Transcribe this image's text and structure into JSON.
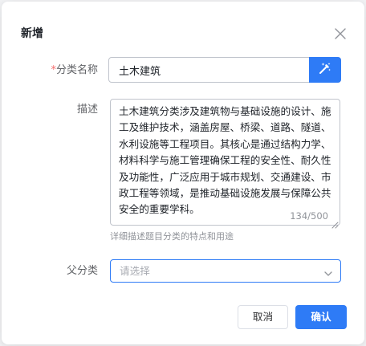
{
  "dialog": {
    "title": "新增",
    "close_icon": "close-icon"
  },
  "form": {
    "name": {
      "required_mark": "*",
      "label": "分类名称",
      "value": "土木建筑",
      "action_icon": "magic-wand-icon"
    },
    "description": {
      "label": "描述",
      "value": "土木建筑分类涉及建筑物与基础设施的设计、施工及维护技术，涵盖房屋、桥梁、道路、隧道、水利设施等工程项目。其核心是通过结构力学、材料科学与施工管理确保工程的安全性、耐久性及功能性，广泛应用于城市规划、交通建设、市政工程等领域，是推动基础设施发展与保障公共安全的重要学科。",
      "counter": "134/500",
      "hint": "详细描述题目分类的特点和用途"
    },
    "parent": {
      "label": "父分类",
      "placeholder": "请选择",
      "dropdown_icon": "chevron-down-icon"
    }
  },
  "footer": {
    "cancel_label": "取消",
    "confirm_label": "确认"
  },
  "colors": {
    "primary": "#2e7bf6",
    "required": "#f56c6c",
    "label": "#606266",
    "muted": "#909399",
    "placeholder": "#a8abb2"
  }
}
